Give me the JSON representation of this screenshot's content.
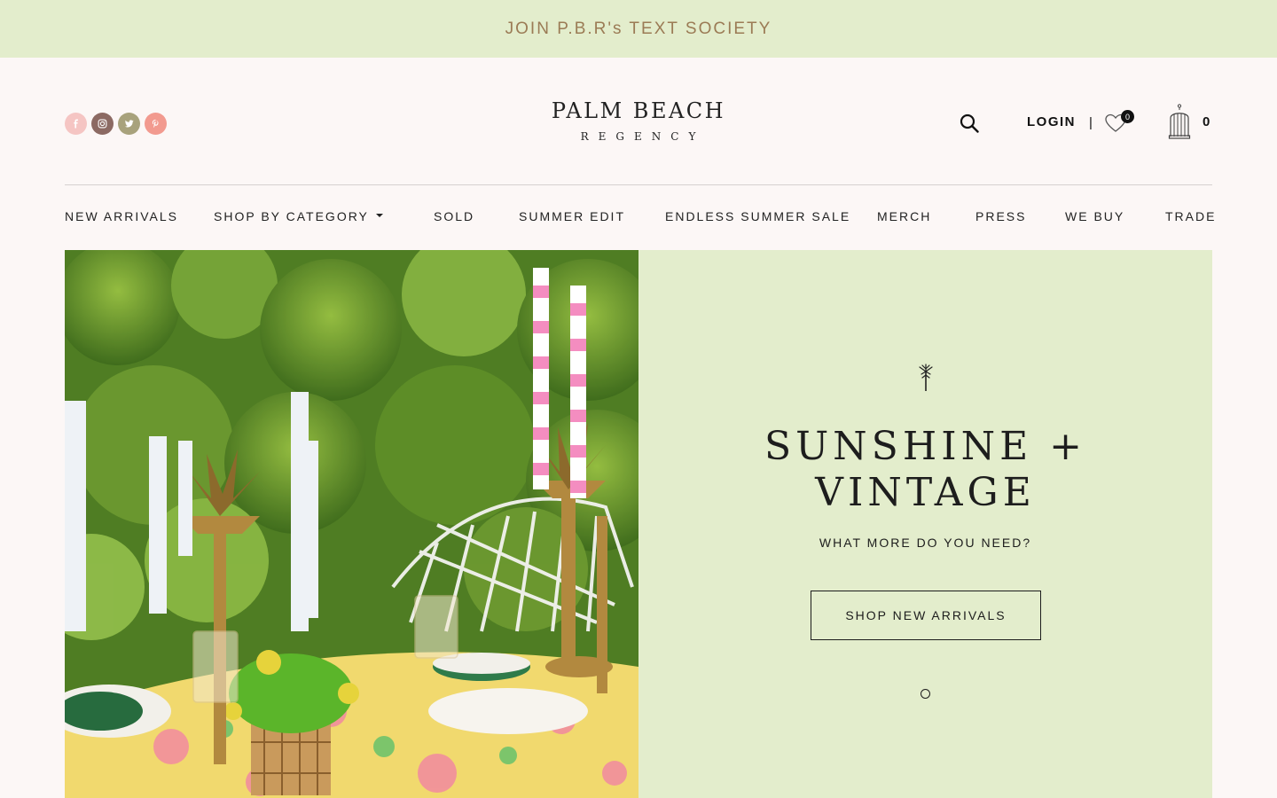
{
  "announcement": {
    "text": "JOIN P.B.R's TEXT SOCIETY"
  },
  "socials": [
    {
      "name": "facebook",
      "color": "#f5c5c3",
      "glyph": "f"
    },
    {
      "name": "instagram",
      "color": "#8c6a63",
      "glyph": "◎"
    },
    {
      "name": "twitter",
      "color": "#a8a27c",
      "glyph": "t"
    },
    {
      "name": "pinterest",
      "color": "#f29a8f",
      "glyph": "p"
    }
  ],
  "logo": {
    "line1": "PALM BEACH",
    "line2": "REGENCY"
  },
  "header": {
    "login": "LOGIN",
    "separator": "|",
    "wishlist_count": "0",
    "cart_count": "0"
  },
  "nav": [
    {
      "label": "NEW ARRIVALS"
    },
    {
      "label": "SHOP BY CATEGORY",
      "dropdown": true
    },
    {
      "label": "SOLD"
    },
    {
      "label": "SUMMER EDIT"
    },
    {
      "label": "ENDLESS SUMMER SALE"
    },
    {
      "label": "MERCH"
    },
    {
      "label": "PRESS"
    },
    {
      "label": "WE BUY"
    },
    {
      "label": "TRADE"
    }
  ],
  "hero": {
    "title_line1": "SUNSHINE +",
    "title_line2": "VINTAGE",
    "subtitle": "WHAT MORE DO YOU NEED?",
    "cta": "SHOP NEW ARRIVALS"
  },
  "colors": {
    "mint": "#e3edcc",
    "gold": "#9b7b55",
    "ink": "#1d1d1d",
    "page": "#fcf7f6"
  }
}
